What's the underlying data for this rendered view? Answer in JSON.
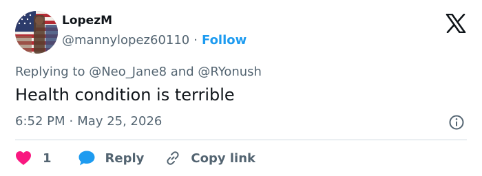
{
  "tweet": {
    "author": {
      "display_name": "LopezM",
      "handle": "@mannylopez60110",
      "follow_label": "Follow",
      "avatar": "avatar-flag-image"
    },
    "separator": "·",
    "reply_context": {
      "prefix": "Replying to",
      "mentions": [
        "@Neo_Jane8",
        "@RYonush"
      ],
      "joiner": "and"
    },
    "text": "Health condition is terrible",
    "time": "6:52 PM",
    "date": "May 25, 2026"
  },
  "actions": {
    "like_count": "1",
    "reply_label": "Reply",
    "copy_link_label": "Copy link"
  },
  "icons": {
    "brand": "x-logo-icon",
    "info": "info-icon",
    "like": "heart-icon",
    "reply": "speech-bubble-icon",
    "copy": "link-icon"
  },
  "colors": {
    "text": "#0f1419",
    "secondary": "#536471",
    "accent": "#1d9bf0",
    "like": "#f91880",
    "divider": "#cfd9de"
  }
}
